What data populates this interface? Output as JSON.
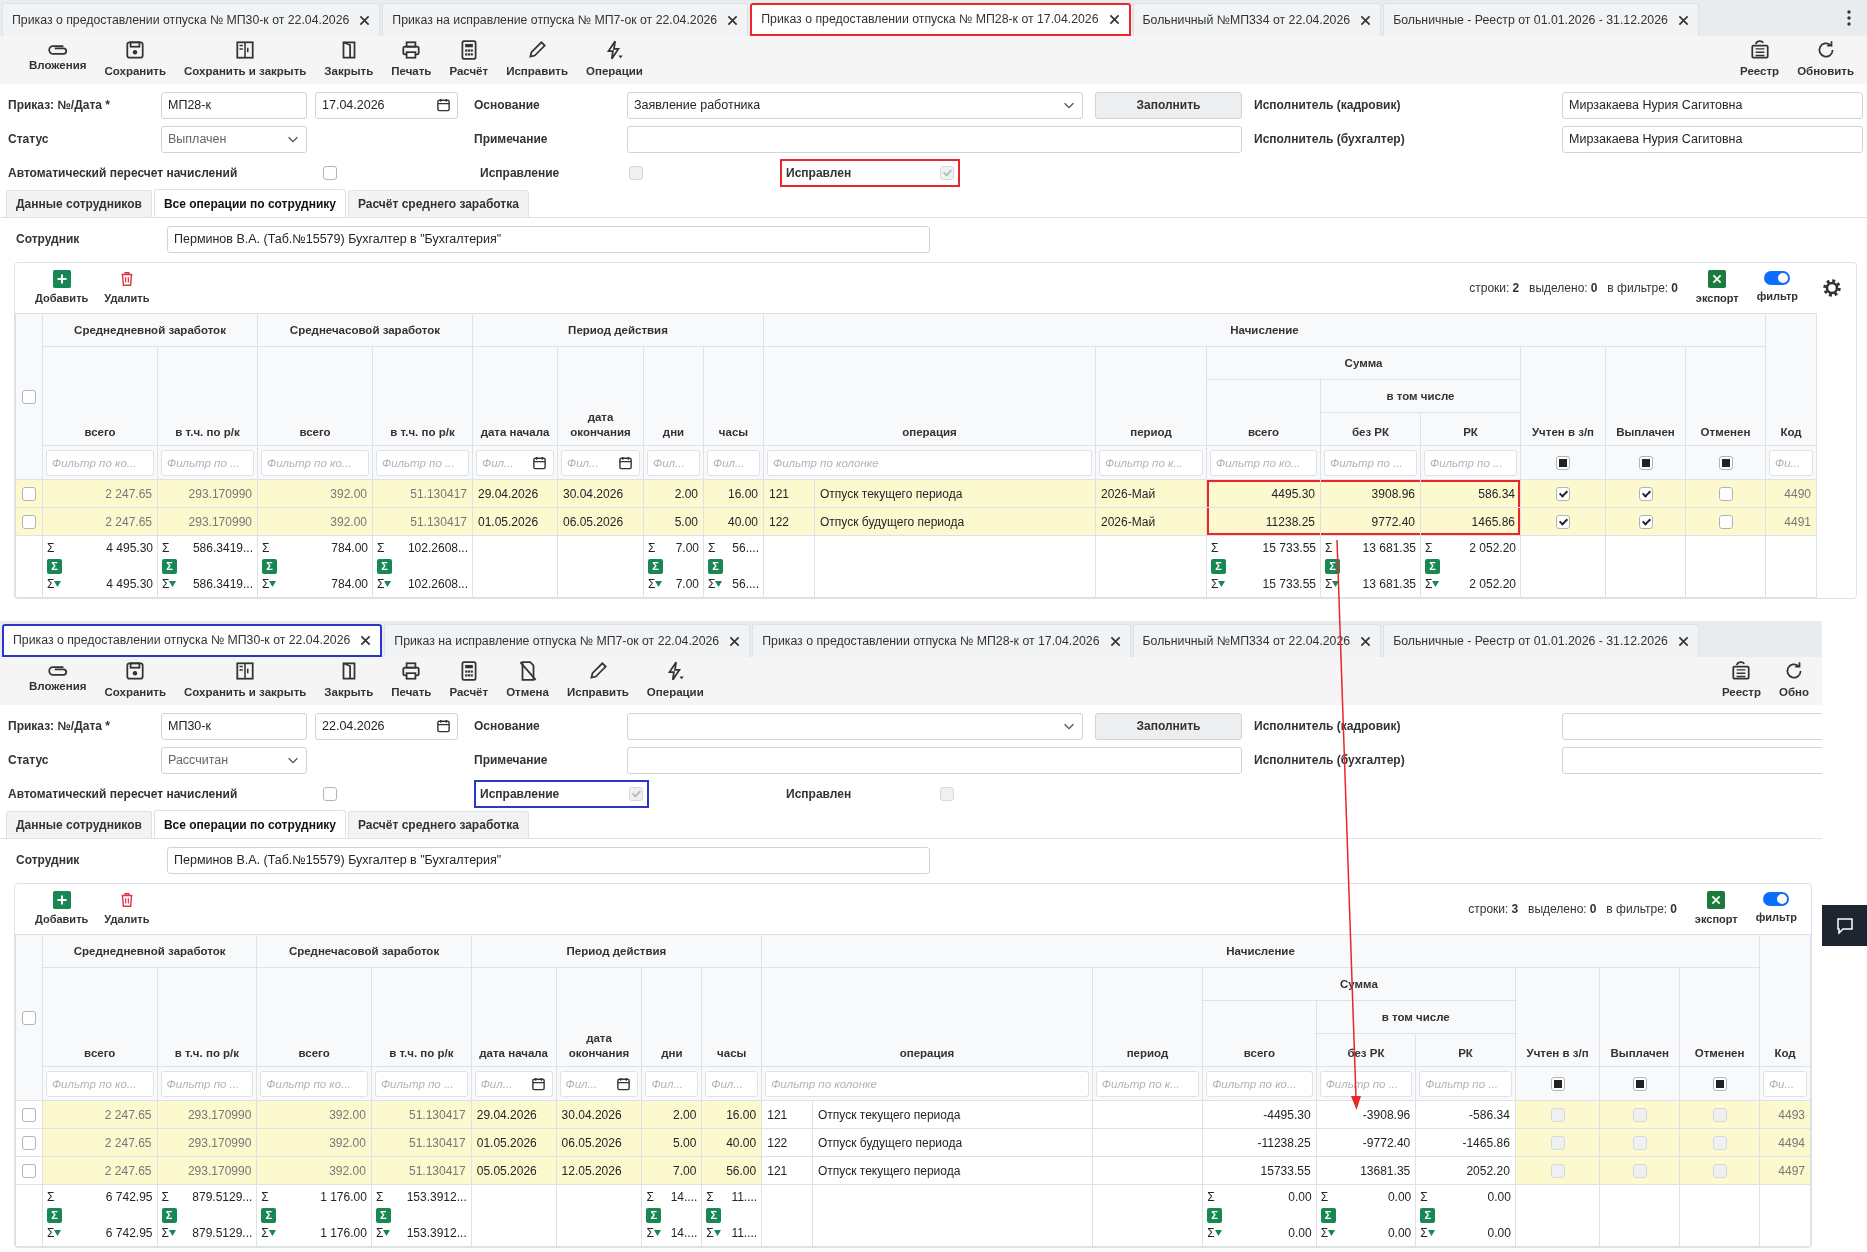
{
  "panels": [
    {
      "tabs": [
        {
          "label": "Приказ о предоставлении отпуска № МП30-к от 22.04.2026",
          "selected": false
        },
        {
          "label": "Приказ на исправление отпуска № МП7-ок от 22.04.2026",
          "selected": false
        },
        {
          "label": "Приказ о предоставлении отпуска № МП28-к от 17.04.2026",
          "selected": true,
          "color": "#e8262b"
        },
        {
          "label": "Больничный №МП334 от 22.04.2026",
          "selected": false
        },
        {
          "label": "Больничные - Реестр от 01.01.2026 - 31.12.2026",
          "selected": false
        }
      ],
      "menu": true,
      "toolbar": {
        "left": [
          {
            "kind": "attach",
            "label": "Вложения"
          },
          {
            "kind": "save",
            "label": "Сохранить"
          },
          {
            "kind": "save-close",
            "label": "Сохранить и закрыть"
          },
          {
            "kind": "close",
            "label": "Закрыть"
          },
          {
            "kind": "print",
            "label": "Печать"
          },
          {
            "kind": "calc",
            "label": "Расчёт"
          },
          {
            "kind": "edit",
            "label": "Исправить"
          },
          {
            "kind": "ops",
            "label": "Операции"
          }
        ],
        "right": [
          {
            "kind": "registry",
            "label": "Реестр"
          },
          {
            "kind": "refresh",
            "label": "Обновить"
          }
        ]
      },
      "form": {
        "number_label": "Приказ: №/Дата *",
        "number": "МП28-к",
        "date": "17.04.2026",
        "status_label": "Статус",
        "status": "Выплачен",
        "auto_label": "Автоматический пересчет начислений",
        "auto_checked": false,
        "basis_label": "Основание",
        "basis": "Заявление работника",
        "fill_button": "Заполнить",
        "note_label": "Примечание",
        "correction": {
          "label": "Исправление",
          "checked": false,
          "disabled": true
        },
        "corrected": {
          "label": "Исправлен",
          "checked": true,
          "disabled": true,
          "color": "#e8262b"
        },
        "hr_label": "Исполнитель (кадровик)",
        "hr": "Мирзакаева Нурия Сагитовна",
        "acc_label": "Исполнитель (бухгалтер)",
        "acc": "Мирзакаева Нурия Сагитовна"
      },
      "subtabs": [
        {
          "label": "Данные сотрудников",
          "selected": false
        },
        {
          "label": "Все операции по сотруднику",
          "selected": true
        },
        {
          "label": "Расчёт среднего заработка",
          "selected": false
        }
      ],
      "employee_label": "Сотрудник",
      "employee": "Перминов В.А. (Таб.№15579) Бухгалтер в \"Бухгалтерия\"",
      "grid": {
        "add": "Добавить",
        "delete": "Удалить",
        "stats": [
          {
            "label": "строки:",
            "value": "2"
          },
          {
            "label": "выделено:",
            "value": "0"
          },
          {
            "label": "в фильтре:",
            "value": "0"
          }
        ],
        "export": "экспорт",
        "filter": {
          "label": "фильтр",
          "on": true
        },
        "settings": true
      },
      "table": {
        "columns": [
          {
            "kind": "select",
            "checked": false
          },
          {
            "label": "Среднедневной заработок",
            "children": [
              {
                "label": "всего",
                "filter": {
                  "kind": "text",
                  "placeholder": "Фильтр по ко..."
                },
                "kind": "number",
                "muted": true,
                "tint": true,
                "footer": {
                  "sigma": "Σ",
                  "total": "4 495.30",
                  "button": "Σ",
                  "filtered_sigma": "Σ",
                  "filtered": "4 495.30"
                }
              },
              {
                "label": "в т.ч. по р/к",
                "filter": {
                  "kind": "text",
                  "placeholder": "Фильтр по ..."
                },
                "kind": "number",
                "muted": true,
                "tint": true,
                "footer": {
                  "sigma": "Σ",
                  "total": "586.3419...",
                  "button": "Σ",
                  "filtered_sigma": "Σ",
                  "filtered": "586.3419..."
                }
              }
            ]
          },
          {
            "label": "Среднечасовой заработок",
            "children": [
              {
                "label": "всего",
                "filter": {
                  "kind": "text",
                  "placeholder": "Фильтр по ко..."
                },
                "kind": "number",
                "muted": true,
                "tint": true,
                "footer": {
                  "sigma": "Σ",
                  "total": "784.00",
                  "button": "Σ",
                  "filtered_sigma": "Σ",
                  "filtered": "784.00"
                }
              },
              {
                "label": "в т.ч. по р/к",
                "filter": {
                  "kind": "text",
                  "placeholder": "Фильтр по ..."
                },
                "kind": "number",
                "muted": true,
                "tint": true,
                "footer": {
                  "sigma": "Σ",
                  "total": "102.2608...",
                  "button": "Σ",
                  "filtered_sigma": "Σ",
                  "filtered": "102.2608..."
                }
              }
            ]
          },
          {
            "label": "Период действия",
            "children": [
              {
                "label": "дата начала",
                "filter": {
                  "kind": "date",
                  "placeholder": "Фил..."
                },
                "kind": "date",
                "tint": true
              },
              {
                "label": "дата окончания",
                "filter": {
                  "kind": "date",
                  "placeholder": "Фил..."
                },
                "kind": "date",
                "tint": true
              },
              {
                "label": "дни",
                "filter": {
                  "kind": "text",
                  "placeholder": "Фил..."
                },
                "kind": "number",
                "tint": true,
                "footer": {
                  "sigma": "Σ",
                  "total": "7.00",
                  "button": "Σ",
                  "filtered_sigma": "Σ",
                  "filtered": "7.00"
                }
              },
              {
                "label": "часы",
                "filter": {
                  "kind": "text",
                  "placeholder": "Фил..."
                },
                "kind": "number",
                "tint": true,
                "footer": {
                  "sigma": "Σ",
                  "total": "56....",
                  "button": "Σ",
                  "filtered_sigma": "Σ",
                  "filtered": "56...."
                }
              }
            ]
          },
          {
            "label": "Начисление",
            "children": [
              {
                "label": "операция",
                "filter": {
                  "kind": "text",
                  "placeholder": "Фильтр по колонке"
                },
                "kind": "operation"
              },
              {
                "label": "период",
                "filter": {
                  "kind": "text",
                  "placeholder": "Фильтр по к..."
                },
                "kind": "text"
              },
              {
                "label": "Сумма",
                "children": [
                  {
                    "label": "всего",
                    "filter": {
                      "kind": "text",
                      "placeholder": "Фильтр по ко..."
                    },
                    "kind": "number",
                    "outlined": true,
                    "footer": {
                      "sigma": "Σ",
                      "total": "15 733.55",
                      "button": "Σ",
                      "filtered_sigma": "Σ",
                      "filtered": "15 733.55"
                    }
                  },
                  {
                    "label": "в том числе",
                    "children": [
                      {
                        "label": "без РК",
                        "filter": {
                          "kind": "text",
                          "placeholder": "Фильтр по ..."
                        },
                        "kind": "number",
                        "outlined": true,
                        "footer": {
                          "sigma": "Σ",
                          "total": "13 681.35",
                          "button": "Σ",
                          "filtered_sigma": "Σ",
                          "filtered": "13 681.35"
                        }
                      },
                      {
                        "label": "РК",
                        "filter": {
                          "kind": "text",
                          "placeholder": "Фильтр по ..."
                        },
                        "kind": "number",
                        "outlined": true,
                        "footer": {
                          "sigma": "Σ",
                          "total": "2 052.20",
                          "button": "Σ",
                          "filtered_sigma": "Σ",
                          "filtered": "2 052.20"
                        }
                      }
                    ]
                  }
                ]
              },
              {
                "label": "Учтен в з/п",
                "filter": {
                  "kind": "check"
                },
                "kind": "check",
                "tint": true
              },
              {
                "label": "Выплачен",
                "filter": {
                  "kind": "check"
                },
                "kind": "check",
                "tint": true
              },
              {
                "label": "Отменен",
                "filter": {
                  "kind": "check"
                },
                "kind": "check",
                "tint": true
              }
            ]
          },
          {
            "label": "Код",
            "filter": {
              "kind": "text",
              "placeholder": "Фи..."
            },
            "kind": "number",
            "muted": true,
            "tint": true
          }
        ],
        "rows": [
          {
            "selected": false,
            "highlighted": true,
            "color": "#e8262b",
            "avg_day": "2 247.65",
            "avg_day_rk": "293.170990",
            "avg_hour": "392.00",
            "avg_hour_rk": "51.130417",
            "start": "29.04.2026",
            "end": "30.04.2026",
            "days": "2.00",
            "hours": "16.00",
            "op_code": "121",
            "operation": "Отпуск текущего периода",
            "period": "2026-Май",
            "total": "4495.30",
            "without_rk": "3908.96",
            "rk": "586.34",
            "accounted": true,
            "paid": true,
            "cancelled": false,
            "code": "4490"
          },
          {
            "selected": false,
            "highlighted": true,
            "color": "#e8262b",
            "avg_day": "2 247.65",
            "avg_day_rk": "293.170990",
            "avg_hour": "392.00",
            "avg_hour_rk": "51.130417",
            "start": "01.05.2026",
            "end": "06.05.2026",
            "days": "5.00",
            "hours": "40.00",
            "op_code": "122",
            "operation": "Отпуск будущего периода",
            "period": "2026-Май",
            "total": "11238.25",
            "without_rk": "9772.40",
            "rk": "1465.86",
            "accounted": true,
            "paid": true,
            "cancelled": false,
            "code": "4491"
          }
        ]
      }
    },
    {
      "tabs": [
        {
          "label": "Приказ о предоставлении отпуска № МП30-к от 22.04.2026",
          "selected": true,
          "color": "#2b35c9"
        },
        {
          "label": "Приказ на исправление отпуска № МП7-ок от 22.04.2026",
          "selected": false
        },
        {
          "label": "Приказ о предоставлении отпуска № МП28-к от 17.04.2026",
          "selected": false
        },
        {
          "label": "Больничный №МП334 от 22.04.2026",
          "selected": false
        },
        {
          "label": "Больничные - Реестр от 01.01.2026 - 31.12.2026",
          "selected": false
        }
      ],
      "toolbar": {
        "left": [
          {
            "kind": "attach",
            "label": "Вложения"
          },
          {
            "kind": "save",
            "label": "Сохранить"
          },
          {
            "kind": "save-close",
            "label": "Сохранить и закрыть"
          },
          {
            "kind": "close",
            "label": "Закрыть"
          },
          {
            "kind": "print",
            "label": "Печать"
          },
          {
            "kind": "calc",
            "label": "Расчёт"
          },
          {
            "kind": "cancel",
            "label": "Отмена"
          },
          {
            "kind": "edit",
            "label": "Исправить"
          },
          {
            "kind": "ops",
            "label": "Операции"
          }
        ],
        "right": [
          {
            "kind": "registry",
            "label": "Реестр"
          },
          {
            "kind": "refresh",
            "label": "Обно"
          }
        ]
      },
      "form": {
        "number_label": "Приказ: №/Дата *",
        "number": "МП30-к",
        "date": "22.04.2026",
        "status_label": "Статус",
        "status": "Рассчитан",
        "auto_label": "Автоматический пересчет начислений",
        "auto_checked": false,
        "basis_label": "Основание",
        "fill_button": "Заполнить",
        "note_label": "Примечание",
        "correction": {
          "label": "Исправление",
          "checked": true,
          "disabled": true,
          "color": "#2b35c9"
        },
        "corrected": {
          "label": "Исправлен",
          "checked": false,
          "disabled": true
        },
        "hr_label": "Исполнитель (кадровик)",
        "acc_label": "Исполнитель (бухгалтер)"
      },
      "subtabs": [
        {
          "label": "Данные сотрудников",
          "selected": false
        },
        {
          "label": "Все операции по сотруднику",
          "selected": true
        },
        {
          "label": "Расчёт среднего заработка",
          "selected": false
        }
      ],
      "employee_label": "Сотрудник",
      "employee": "Перминов В.А. (Таб.№15579) Бухгалтер в \"Бухгалтерия\"",
      "grid": {
        "add": "Добавить",
        "delete": "Удалить",
        "stats": [
          {
            "label": "строки:",
            "value": "3"
          },
          {
            "label": "выделено:",
            "value": "0"
          },
          {
            "label": "в фильтре:",
            "value": "0"
          }
        ],
        "export": "экспорт",
        "filter": {
          "label": "фильтр",
          "on": true
        }
      },
      "table": {
        "columns": [
          {
            "kind": "select",
            "checked": false
          },
          {
            "label": "Среднедневной заработок",
            "children": [
              {
                "label": "всего",
                "filter": {
                  "kind": "text",
                  "placeholder": "Фильтр по ко..."
                },
                "kind": "number",
                "muted": true,
                "tint": true,
                "footer": {
                  "sigma": "Σ",
                  "total": "6 742.95",
                  "button": "Σ",
                  "filtered_sigma": "Σ",
                  "filtered": "6 742.95"
                }
              },
              {
                "label": "в т.ч. по р/к",
                "filter": {
                  "kind": "text",
                  "placeholder": "Фильтр по ..."
                },
                "kind": "number",
                "muted": true,
                "tint": true,
                "footer": {
                  "sigma": "Σ",
                  "total": "879.5129...",
                  "button": "Σ",
                  "filtered_sigma": "Σ",
                  "filtered": "879.5129..."
                }
              }
            ]
          },
          {
            "label": "Среднечасовой заработок",
            "children": [
              {
                "label": "всего",
                "filter": {
                  "kind": "text",
                  "placeholder": "Фильтр по ко..."
                },
                "kind": "number",
                "muted": true,
                "tint": true,
                "footer": {
                  "sigma": "Σ",
                  "total": "1 176.00",
                  "button": "Σ",
                  "filtered_sigma": "Σ",
                  "filtered": "1 176.00"
                }
              },
              {
                "label": "в т.ч. по р/к",
                "filter": {
                  "kind": "text",
                  "placeholder": "Фильтр по ..."
                },
                "kind": "number",
                "muted": true,
                "tint": true,
                "footer": {
                  "sigma": "Σ",
                  "total": "153.3912...",
                  "button": "Σ",
                  "filtered_sigma": "Σ",
                  "filtered": "153.3912..."
                }
              }
            ]
          },
          {
            "label": "Период действия",
            "children": [
              {
                "label": "дата начала",
                "filter": {
                  "kind": "date",
                  "placeholder": "Фил..."
                },
                "kind": "date",
                "tint": true
              },
              {
                "label": "дата окончания",
                "filter": {
                  "kind": "date",
                  "placeholder": "Фил..."
                },
                "kind": "date",
                "tint": true
              },
              {
                "label": "дни",
                "filter": {
                  "kind": "text",
                  "placeholder": "Фил..."
                },
                "kind": "number",
                "tint": true,
                "footer": {
                  "sigma": "Σ",
                  "total": "14....",
                  "button": "Σ",
                  "filtered_sigma": "Σ",
                  "filtered": "14...."
                }
              },
              {
                "label": "часы",
                "filter": {
                  "kind": "text",
                  "placeholder": "Фил..."
                },
                "kind": "number",
                "tint": true,
                "footer": {
                  "sigma": "Σ",
                  "total": "11....",
                  "button": "Σ",
                  "filtered_sigma": "Σ",
                  "filtered": "11...."
                }
              }
            ]
          },
          {
            "label": "Начисление",
            "children": [
              {
                "label": "операция",
                "filter": {
                  "kind": "text",
                  "placeholder": "Фильтр по колонке"
                },
                "kind": "operation"
              },
              {
                "label": "период",
                "filter": {
                  "kind": "text",
                  "placeholder": "Фильтр по к..."
                },
                "kind": "text"
              },
              {
                "label": "Сумма",
                "children": [
                  {
                    "label": "всего",
                    "filter": {
                      "kind": "text",
                      "placeholder": "Фильтр по ко..."
                    },
                    "kind": "number",
                    "footer": {
                      "sigma": "Σ",
                      "total": "0.00",
                      "button": "Σ",
                      "filtered_sigma": "Σ",
                      "filtered": "0.00"
                    }
                  },
                  {
                    "label": "в том числе",
                    "children": [
                      {
                        "label": "без РК",
                        "filter": {
                          "kind": "text",
                          "placeholder": "Фильтр по ..."
                        },
                        "kind": "number",
                        "footer": {
                          "sigma": "Σ",
                          "total": "0.00",
                          "button": "Σ",
                          "filtered_sigma": "Σ",
                          "filtered": "0.00"
                        }
                      },
                      {
                        "label": "РК",
                        "filter": {
                          "kind": "text",
                          "placeholder": "Фильтр по ..."
                        },
                        "kind": "number",
                        "footer": {
                          "sigma": "Σ",
                          "total": "0.00",
                          "button": "Σ",
                          "filtered_sigma": "Σ",
                          "filtered": "0.00"
                        }
                      }
                    ]
                  }
                ]
              },
              {
                "label": "Учтен в з/п",
                "filter": {
                  "kind": "check"
                },
                "kind": "check",
                "tint": true
              },
              {
                "label": "Выплачен",
                "filter": {
                  "kind": "check"
                },
                "kind": "check",
                "tint": true
              },
              {
                "label": "Отменен",
                "filter": {
                  "kind": "check"
                },
                "kind": "check",
                "tint": true
              }
            ]
          },
          {
            "label": "Код",
            "filter": {
              "kind": "text",
              "placeholder": "Фи..."
            },
            "kind": "number",
            "muted": true,
            "tint": true
          }
        ],
        "rows": [
          {
            "selected": false,
            "highlighted": false,
            "avg_day": "2 247.65",
            "avg_day_rk": "293.170990",
            "avg_hour": "392.00",
            "avg_hour_rk": "51.130417",
            "start": "29.04.2026",
            "end": "30.04.2026",
            "days": "2.00",
            "hours": "16.00",
            "op_code": "121",
            "operation": "Отпуск текущего периода",
            "total": "-4495.30",
            "without_rk": "-3908.96",
            "rk": "-586.34",
            "accounted": false,
            "paid": false,
            "cancelled": false,
            "code": "4493"
          },
          {
            "selected": false,
            "highlighted": false,
            "avg_day": "2 247.65",
            "avg_day_rk": "293.170990",
            "avg_hour": "392.00",
            "avg_hour_rk": "51.130417",
            "start": "01.05.2026",
            "end": "06.05.2026",
            "days": "5.00",
            "hours": "40.00",
            "op_code": "122",
            "operation": "Отпуск будущего периода",
            "total": "-11238.25",
            "without_rk": "-9772.40",
            "rk": "-1465.86",
            "accounted": false,
            "paid": false,
            "cancelled": false,
            "code": "4494"
          },
          {
            "selected": false,
            "highlighted": false,
            "avg_day": "2 247.65",
            "avg_day_rk": "293.170990",
            "avg_hour": "392.00",
            "avg_hour_rk": "51.130417",
            "start": "05.05.2026",
            "end": "12.05.2026",
            "days": "7.00",
            "hours": "56.00",
            "op_code": "121",
            "operation": "Отпуск текущего периода",
            "total": "15733.55",
            "without_rk": "13681.35",
            "rk": "2052.20",
            "accounted": false,
            "paid": false,
            "cancelled": false,
            "code": "4497"
          }
        ]
      }
    }
  ]
}
